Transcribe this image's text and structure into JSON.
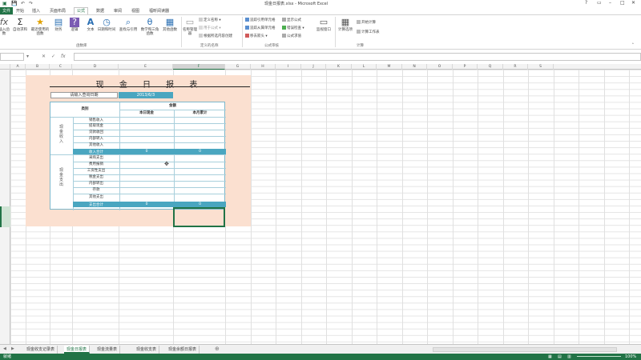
{
  "window": {
    "title": "现金日报表.xlsx - Microsoft Excel"
  },
  "tabs": [
    "文件",
    "开始",
    "插入",
    "页面布局",
    "公式",
    "数据",
    "审阅",
    "视图",
    "福昕阅读器"
  ],
  "ribbon": {
    "buttons": [
      {
        "label": "插入函数",
        "icon": "fx"
      },
      {
        "label": "自动求和",
        "icon": "Σ"
      },
      {
        "label": "最近使用的函数",
        "icon": "★"
      },
      {
        "label": "财务",
        "icon": "▤"
      },
      {
        "label": "逻辑",
        "icon": "?"
      },
      {
        "label": "文本",
        "icon": "A"
      },
      {
        "label": "日期和时间",
        "icon": "◷"
      },
      {
        "label": "查找与引用",
        "icon": "⌕"
      },
      {
        "label": "数学和三角函数",
        "icon": "θ"
      },
      {
        "label": "其他函数",
        "icon": "▦"
      },
      {
        "label": "名称管理器",
        "icon": "▭"
      }
    ],
    "defined_names": [
      "定义名称",
      "用于公式",
      "根据所选内容创建"
    ],
    "audit": [
      "追踪引用单元格",
      "追踪从属单元格",
      "移去箭头",
      "显示公式",
      "错误检查",
      "公式求值"
    ],
    "watch": "监视窗口",
    "calc": [
      "计算选项",
      "开始计算",
      "计算工作表"
    ],
    "groups": [
      "函数库",
      "定义的名称",
      "公式审核",
      "计算"
    ]
  },
  "formulabar": {
    "namebox": "",
    "formula": ""
  },
  "columns": [
    "A",
    "B",
    "C",
    "D",
    "E",
    "F",
    "G",
    "H",
    "I",
    "J",
    "K",
    "L",
    "M",
    "N",
    "O",
    "P",
    "Q",
    "R",
    "S"
  ],
  "report": {
    "title": "现 金 日 报 表",
    "date_label": "请输入查询日期",
    "date_value": "2013/6/3",
    "header_category": "类别",
    "header_amount": "金额",
    "header_today": "本日现金",
    "header_month": "本月累计",
    "income_label": "现金收入",
    "income_items": [
      "销售收入",
      "提取现金",
      "贷款收回",
      "内部转入",
      "其他收入"
    ],
    "income_total": "收入合计",
    "income_total_today": "0",
    "income_total_month": "0",
    "expense_label": "现金支出",
    "expense_items": [
      "采购支出",
      "费用报销",
      "工资性支出",
      "税金支出",
      "内部转出",
      "存款",
      "其他支出"
    ],
    "expense_total": "支出合计",
    "expense_total_today": "0",
    "expense_total_month": "0"
  },
  "sheets": [
    "现金收支记录表",
    "现金日报表",
    "现金流量表",
    "现金收支表",
    "现金余额日报表"
  ],
  "active_sheet": 1,
  "status": {
    "ready": "就绪",
    "zoom": "100%"
  }
}
